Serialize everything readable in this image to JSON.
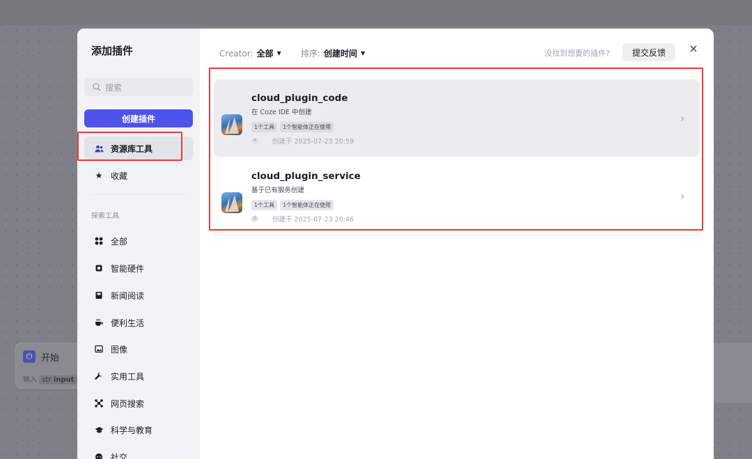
{
  "canvas": {
    "start_node": {
      "title": "开始",
      "input_prefix": "输入",
      "input_type": "str",
      "input_name": "input"
    }
  },
  "modal": {
    "title": "添加插件",
    "search_placeholder": "搜索",
    "create_button": "创建插件",
    "nav_primary": [
      {
        "label": "资源库工具",
        "icon": "users-icon",
        "active": true
      },
      {
        "label": "收藏",
        "icon": "star-icon",
        "active": false
      }
    ],
    "explore_label": "探索工具",
    "categories": [
      {
        "label": "全部",
        "icon": "grid-icon"
      },
      {
        "label": "智能硬件",
        "icon": "chip-icon"
      },
      {
        "label": "新闻阅读",
        "icon": "book-icon"
      },
      {
        "label": "便利生活",
        "icon": "cup-icon"
      },
      {
        "label": "图像",
        "icon": "image-icon"
      },
      {
        "label": "实用工具",
        "icon": "wrench-icon"
      },
      {
        "label": "网页搜索",
        "icon": "network-icon"
      },
      {
        "label": "科学与教育",
        "icon": "graduation-cap-icon"
      },
      {
        "label": "社交",
        "icon": "chat-icon"
      }
    ],
    "filters": {
      "creator_label": "Creator:",
      "creator_value": "全部",
      "sort_label": "排序:",
      "sort_value": "创建时间"
    },
    "not_found_text": "没找到想要的插件?",
    "feedback_button": "提交反馈",
    "close_symbol": "×",
    "plugins": [
      {
        "name": "cloud_plugin_code",
        "description": "在 Coze IDE 中创建",
        "tags": [
          "1个工具",
          "1个智能体正在使用"
        ],
        "avatar_letter": "A",
        "created": "创建于 2025-07-23 20:59"
      },
      {
        "name": "cloud_plugin_service",
        "description": "基于已有服务创建",
        "tags": [
          "1个工具",
          "1个智能体正在使用"
        ],
        "avatar_letter": "A",
        "created": "创建于 2025-07-23 20:46"
      }
    ]
  },
  "colors": {
    "accent": "#4d53e8",
    "highlight_box": "#e53935"
  }
}
